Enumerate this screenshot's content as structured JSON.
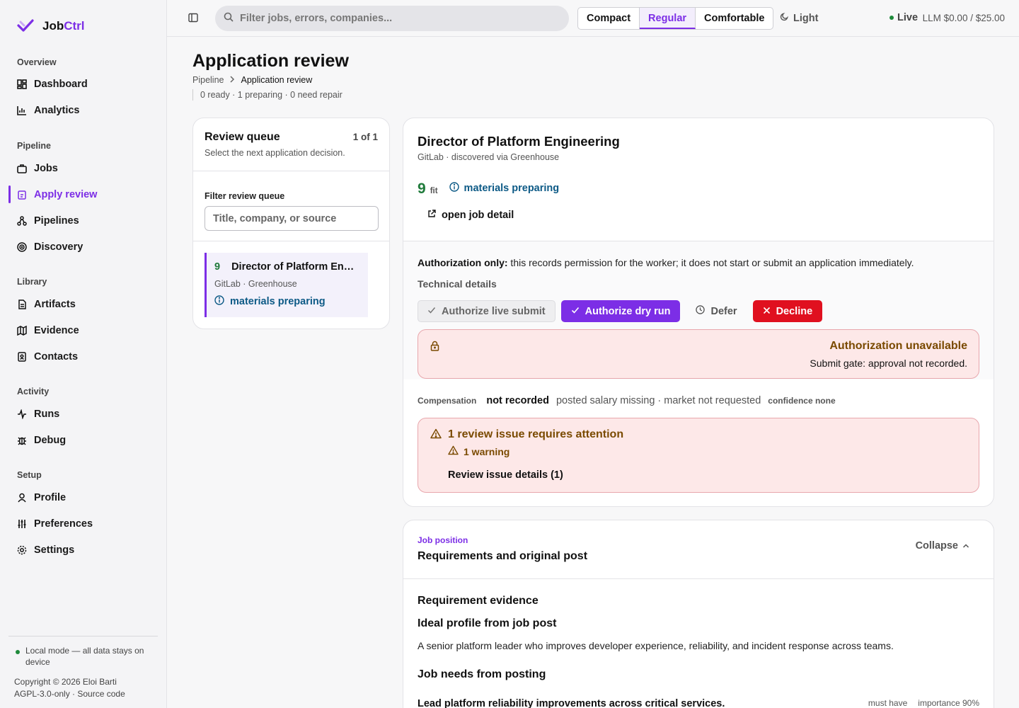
{
  "brand": {
    "name_plain": "Job",
    "name_accent": "Ctrl"
  },
  "nav": {
    "overview": {
      "heading": "Overview",
      "items": [
        "Dashboard",
        "Analytics"
      ]
    },
    "pipeline": {
      "heading": "Pipeline",
      "items": [
        "Jobs",
        "Apply review",
        "Pipelines",
        "Discovery"
      ]
    },
    "library": {
      "heading": "Library",
      "items": [
        "Artifacts",
        "Evidence",
        "Contacts"
      ]
    },
    "activity": {
      "heading": "Activity",
      "items": [
        "Runs",
        "Debug"
      ]
    },
    "setup": {
      "heading": "Setup",
      "items": [
        "Profile",
        "Preferences",
        "Settings"
      ]
    },
    "active_item": "Apply review"
  },
  "footer": {
    "local_mode": "Local mode — all data stays on device",
    "copyright": "Copyright © 2026 Eloi Barti",
    "license": "AGPL-3.0-only · Source code"
  },
  "topbar": {
    "search_placeholder": "Filter jobs, errors, companies...",
    "density": [
      "Compact",
      "Regular",
      "Comfortable"
    ],
    "density_selected": "Regular",
    "theme": "Light",
    "live": "Live",
    "llm": "LLM $0.00 / $25.00"
  },
  "page": {
    "title": "Application review",
    "breadcrumb": [
      "Pipeline",
      "Application review"
    ],
    "counts": "0 ready · 1 preparing · 0 need repair"
  },
  "queue": {
    "title": "Review queue",
    "count": "1 of 1",
    "subtitle": "Select the next application decision.",
    "filter_label": "Filter review queue",
    "filter_placeholder": "Title, company, or source",
    "items": [
      {
        "score": "9",
        "title": "Director of Platform Engineering",
        "meta": "GitLab · Greenhouse",
        "status": "materials preparing"
      }
    ]
  },
  "detail": {
    "title": "Director of Platform Engineering",
    "meta": "GitLab · discovered via Greenhouse",
    "fit_score": "9",
    "fit_label": "fit",
    "status": "materials preparing",
    "open_detail": "open job detail",
    "auth_note_bold": "Authorization only:",
    "auth_note": " this records permission for the worker; it does not start or submit an application immediately.",
    "technical_details": "Technical details",
    "actions": {
      "live": "Authorize live submit",
      "dry": "Authorize dry run",
      "defer": "Defer",
      "decline": "Decline"
    },
    "unavailable_title": "Authorization unavailable",
    "unavailable_sub": "Submit gate: approval not recorded.",
    "compensation": {
      "label": "Compensation",
      "value": "not recorded",
      "note": "posted salary missing · market not requested",
      "confidence": "confidence none"
    },
    "issue": {
      "title": "1 review issue requires attention",
      "warning": "1 warning",
      "details": "Review issue details (1)"
    }
  },
  "job_position": {
    "eyebrow": "Job position",
    "title": "Requirements and original post",
    "collapse": "Collapse",
    "requirement_evidence": "Requirement evidence",
    "ideal_heading": "Ideal profile from job post",
    "ideal_text": "A senior platform leader who improves developer experience, reliability, and incident response across teams.",
    "needs_heading": "Job needs from posting",
    "needs": [
      {
        "text": "Lead platform reliability improvements across critical services.",
        "tag": "must have",
        "importance": "importance 90%"
      }
    ]
  },
  "colors": {
    "accent": "#7c2ee6",
    "success": "#1f7a3a",
    "info": "#0d5a86",
    "danger": "#e0101f",
    "warning_text": "#7a4a00"
  }
}
